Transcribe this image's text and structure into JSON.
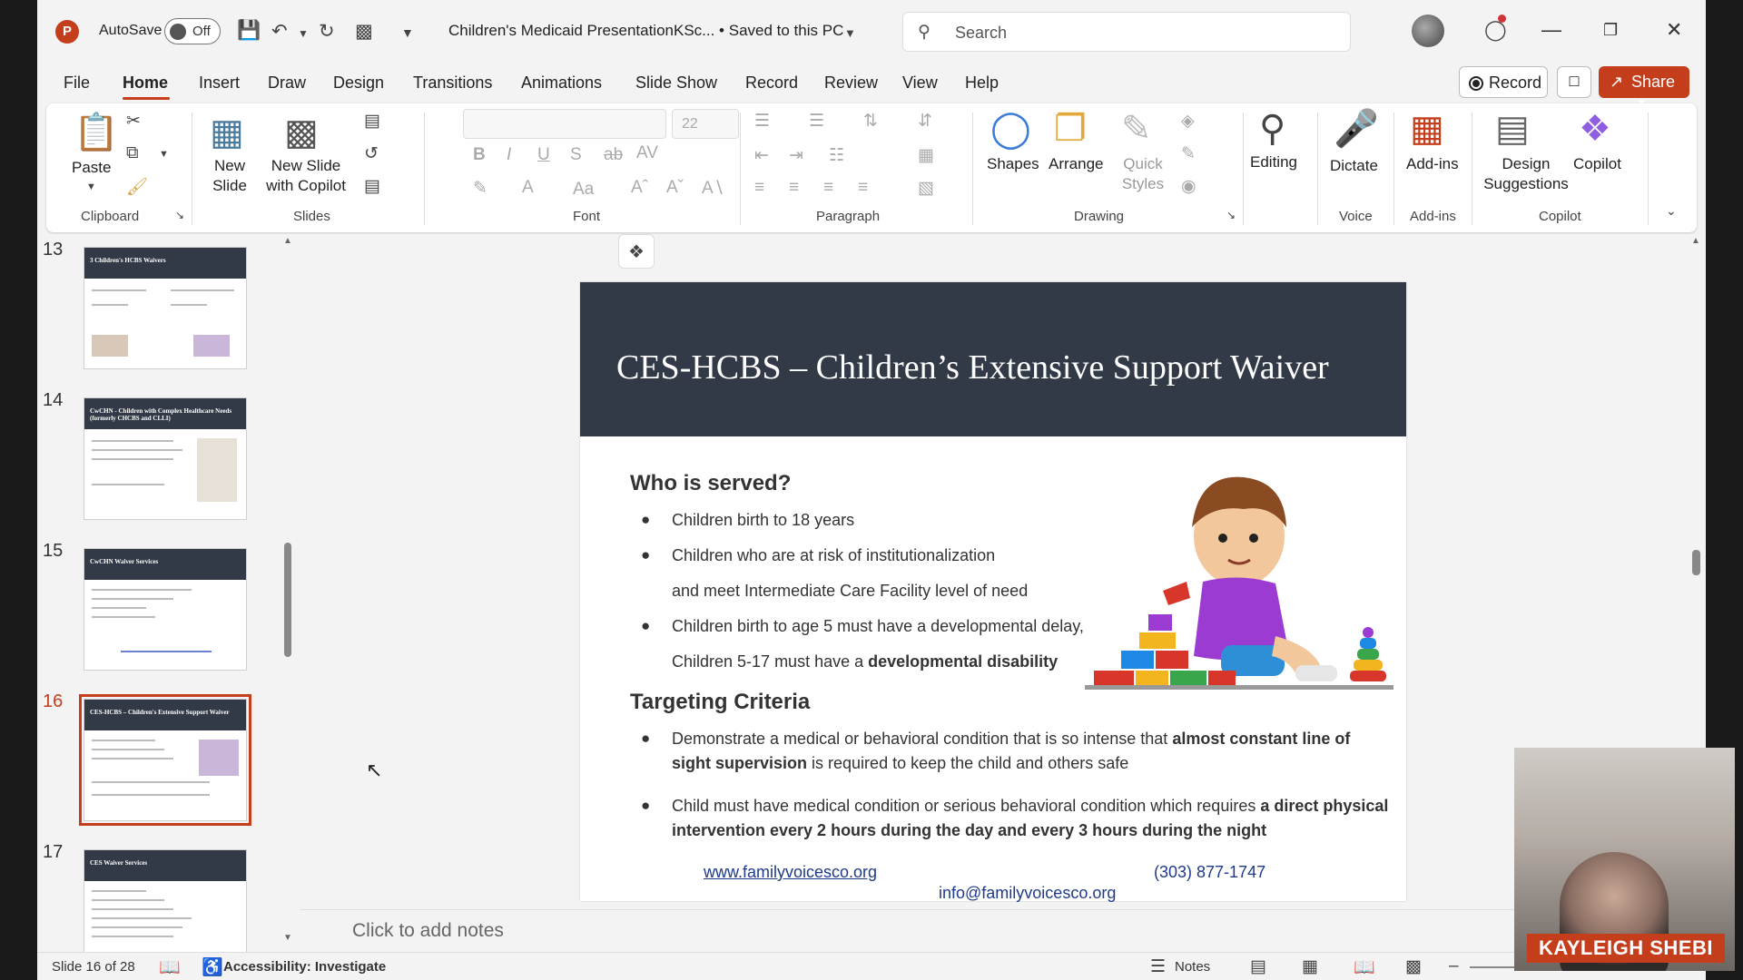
{
  "app": {
    "autosave_label": "AutoSave",
    "autosave_state": "Off",
    "doc_title": "Children's Medicaid PresentationKSc... • Saved to this PC",
    "search_placeholder": "Search"
  },
  "menu": {
    "items": [
      "File",
      "Home",
      "Insert",
      "Draw",
      "Design",
      "Transitions",
      "Animations",
      "Slide Show",
      "Record",
      "Review",
      "View",
      "Help"
    ],
    "active": "Home",
    "record_label": "Record",
    "share_label": "Share"
  },
  "ribbon": {
    "clipboard": {
      "paste": "Paste",
      "group": "Clipboard"
    },
    "slides": {
      "new_slide": "New Slide",
      "new_slide_copilot": "New Slide with Copilot",
      "group": "Slides"
    },
    "font": {
      "size": "22",
      "group": "Font"
    },
    "paragraph": {
      "group": "Paragraph"
    },
    "drawing": {
      "shapes": "Shapes",
      "arrange": "Arrange",
      "quick_styles": "Quick Styles",
      "group": "Drawing"
    },
    "editing": {
      "label": "Editing"
    },
    "voice": {
      "dictate": "Dictate",
      "group": "Voice"
    },
    "addins": {
      "label": "Add-ins",
      "group": "Add-ins"
    },
    "copilot": {
      "design_suggestions": "Design Suggestions",
      "copilot": "Copilot",
      "group": "Copilot"
    }
  },
  "thumbnails": [
    {
      "num": "13",
      "title": "3 Children's HCBS Waivers",
      "selected": false
    },
    {
      "num": "14",
      "title": "CwCHN - Children with Complex Healthcare Needs (formerly CHCBS and CLLI)",
      "selected": false
    },
    {
      "num": "15",
      "title": "CwCHN Waiver Services",
      "selected": false
    },
    {
      "num": "16",
      "title": "CES-HCBS – Children's Extensive Support Waiver",
      "selected": true
    },
    {
      "num": "17",
      "title": "CES Waiver Services",
      "selected": false
    }
  ],
  "slide": {
    "title": "CES-HCBS  – Children’s Extensive Support Waiver",
    "section1": "Who is served?",
    "b1": "Children birth to 18 years",
    "b2_line1": "Children who are at risk of institutionalization",
    "b2_line2": "and meet Intermediate Care Facility level of need",
    "b3_line1": "Children birth to age 5 must have a developmental delay,",
    "b3_line2_pre": "Children 5-17 must have a ",
    "b3_line2_bold": "developmental disability",
    "section2": "Targeting Criteria",
    "t1_pre": "Demonstrate a medical or behavioral condition that is so intense that ",
    "t1_bold": "almost constant line of sight supervision",
    "t1_post": " is required to keep the child and others safe",
    "t2_pre": "Child must have medical condition or serious behavioral condition which requires ",
    "t2_bold": "a direct physical intervention every 2 hours during the day and every 3 hours during the night",
    "website": "www.familyvoicesco.org",
    "phone": "(303) 877-1747",
    "email": "info@familyvoicesco.org"
  },
  "notes_placeholder": "Click to add notes",
  "status": {
    "slide_counter": "Slide 16 of 28",
    "accessibility": "Accessibility: Investigate",
    "notes": "Notes"
  },
  "webcam": {
    "name": "KAYLEIGH SHEBI"
  },
  "colors": {
    "accent": "#c43e1c",
    "slide_header": "#323a47",
    "link": "#1f3a8a"
  }
}
